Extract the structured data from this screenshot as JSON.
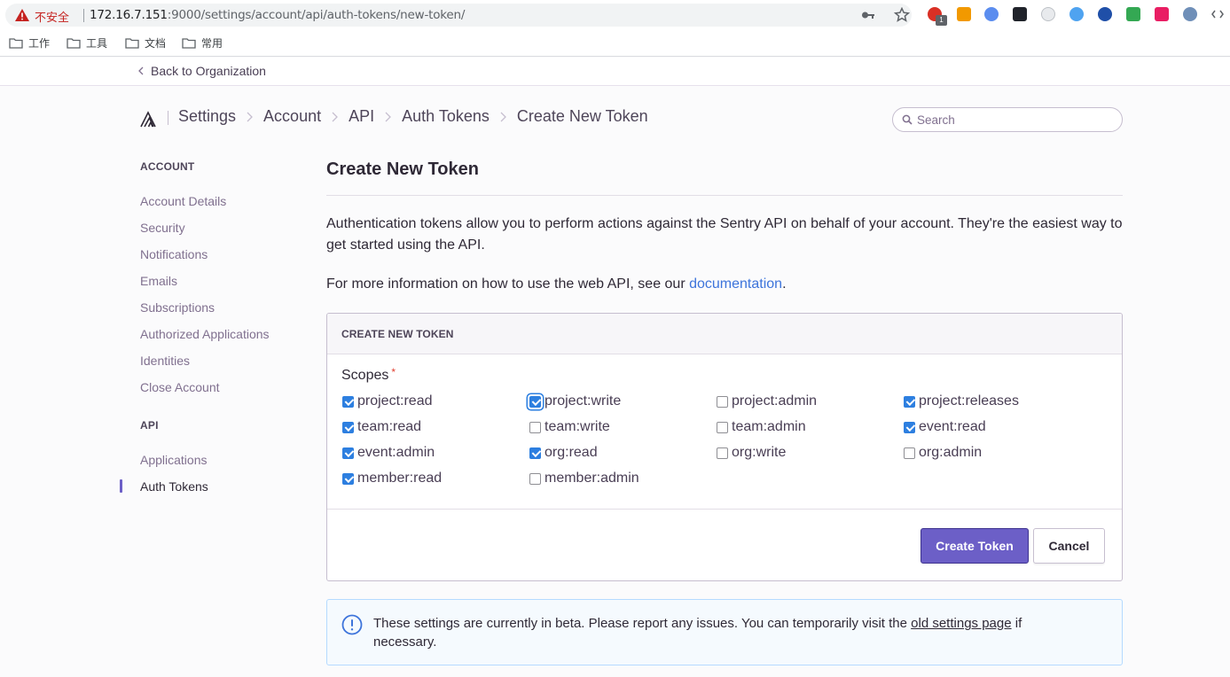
{
  "browser": {
    "insecure_label": "不安全",
    "url_host": "172.16.7.151",
    "url_rest": ":9000/settings/account/api/auth-tokens/new-token/",
    "extension_badge": "1",
    "bookmarks": [
      "工作",
      "工具",
      "文档",
      "常用"
    ]
  },
  "back_link": "Back to Organization",
  "breadcrumbs": [
    "Settings",
    "Account",
    "API",
    "Auth Tokens",
    "Create New Token"
  ],
  "search": {
    "placeholder": "Search"
  },
  "sidebar": {
    "account_heading": "ACCOUNT",
    "account_items": [
      "Account Details",
      "Security",
      "Notifications",
      "Emails",
      "Subscriptions",
      "Authorized Applications",
      "Identities",
      "Close Account"
    ],
    "api_heading": "API",
    "api_items": [
      "Applications",
      "Auth Tokens"
    ],
    "active_item": "Auth Tokens"
  },
  "main": {
    "title": "Create New Token",
    "intro": "Authentication tokens allow you to perform actions against the Sentry API on behalf of your account. They're the easiest way to get started using the API.",
    "moreinfo_prefix": "For more information on how to use the web API, see our ",
    "moreinfo_link": "documentation",
    "moreinfo_suffix": "."
  },
  "panel": {
    "heading": "CREATE NEW TOKEN",
    "scopes_label": "Scopes",
    "required_marker": "*",
    "scopes": [
      {
        "name": "project:read",
        "checked": true
      },
      {
        "name": "project:write",
        "checked": true
      },
      {
        "name": "project:admin",
        "checked": false
      },
      {
        "name": "project:releases",
        "checked": true
      },
      {
        "name": "team:read",
        "checked": true
      },
      {
        "name": "team:write",
        "checked": false
      },
      {
        "name": "team:admin",
        "checked": false
      },
      {
        "name": "event:read",
        "checked": true
      },
      {
        "name": "event:admin",
        "checked": true
      },
      {
        "name": "org:read",
        "checked": true
      },
      {
        "name": "org:write",
        "checked": false
      },
      {
        "name": "org:admin",
        "checked": false
      },
      {
        "name": "member:read",
        "checked": true
      },
      {
        "name": "member:admin",
        "checked": false
      }
    ],
    "create_button": "Create Token",
    "cancel_button": "Cancel"
  },
  "alert": {
    "text_prefix": "These settings are currently in beta. Please report any issues. You can temporarily visit the ",
    "link": "old settings page",
    "text_suffix": " if necessary."
  },
  "colors": {
    "accent": "#6c5fc7",
    "link": "#3d74db",
    "checkbox": "#2d7fe0",
    "alert_bg": "#f5fafe"
  }
}
